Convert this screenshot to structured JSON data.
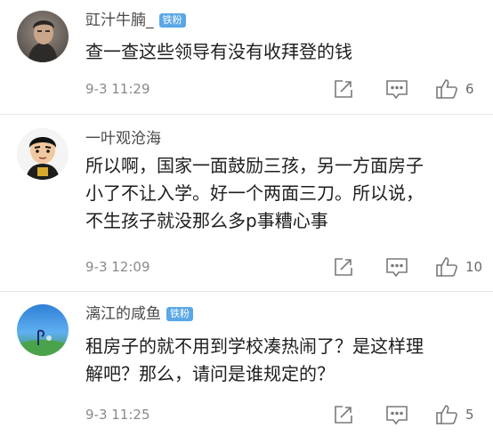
{
  "comments": [
    {
      "username": "豇汁牛腩_",
      "badge": "铁粉",
      "content_lines": [
        "查一查这些领导有没有收拜登的钱"
      ],
      "timestamp": "9-3 11:29",
      "likes": "6",
      "edit_icon": "share-edit-icon",
      "reply_icon": "comment-icon",
      "like_icon": "thumbs-up-icon"
    },
    {
      "username": "一叶观沧海",
      "badge": "",
      "content_lines": [
        "所以啊，国家一面鼓励三孩，另一方面房子",
        "小了不让入学。好一个两面三刀。所以说，",
        "不生孩子就没那么多p事糟心事"
      ],
      "timestamp": "9-3 12:09",
      "likes": "10",
      "edit_icon": "share-edit-icon",
      "reply_icon": "comment-icon",
      "like_icon": "thumbs-up-icon"
    },
    {
      "username": "漓江的咸鱼",
      "badge": "铁粉",
      "content_lines": [
        "租房子的就不用到学校凑热闹了？是这样理",
        "解吧？那么，请问是谁规定的？"
      ],
      "timestamp": "9-3 11:25",
      "likes": "5",
      "edit_icon": "share-edit-icon",
      "reply_icon": "comment-icon",
      "like_icon": "thumbs-up-icon"
    }
  ],
  "colors": {
    "badge": "#5aa7e6",
    "username": "#4a4a4a",
    "content": "#1e1e1e",
    "meta": "#8a8a8a",
    "divider": "#e6e6e6"
  }
}
